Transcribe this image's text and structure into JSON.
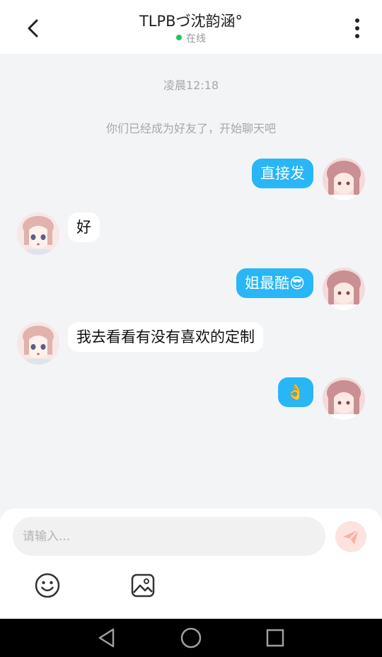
{
  "header": {
    "title": "TLPBづ沈韵涵°",
    "status": "在线"
  },
  "chat": {
    "time": "凌晨12:18",
    "system_note": "你们已经成为好友了，开始聊天吧",
    "messages": [
      {
        "side": "out",
        "text": "直接发"
      },
      {
        "side": "in",
        "text": "好"
      },
      {
        "side": "out",
        "text": "姐最酷😎"
      },
      {
        "side": "in",
        "text": "我去看看有没有喜欢的定制"
      },
      {
        "side": "out",
        "text": "👌"
      }
    ]
  },
  "composer": {
    "placeholder": "请输入..."
  },
  "colors": {
    "outgoing_bubble": "#29b6f6",
    "incoming_bubble": "#ffffff",
    "online_dot": "#22c55e",
    "send_button": "#fde3df"
  },
  "icons": [
    "back-arrow-icon",
    "more-vertical-icon",
    "send-icon",
    "emoji-icon",
    "image-icon",
    "nav-back-icon",
    "nav-home-icon",
    "nav-recent-icon"
  ]
}
